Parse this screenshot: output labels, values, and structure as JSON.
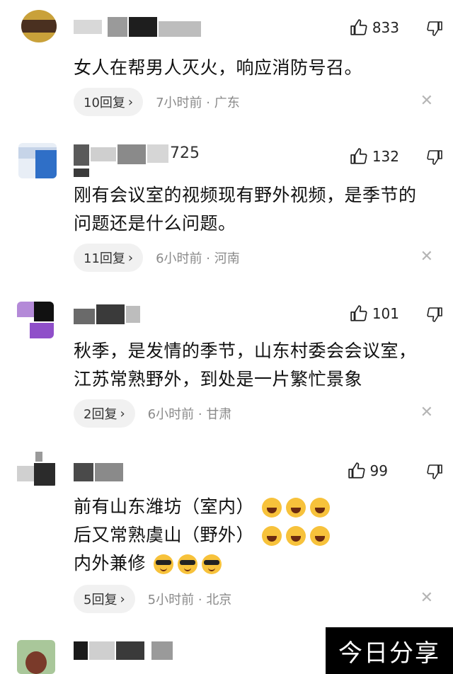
{
  "comments": [
    {
      "likes": "833",
      "text": [
        "女人在帮男人灭火，响应消防号召。"
      ],
      "replies": "10回复",
      "time": "7小时前",
      "location": "广东",
      "name_fragment": ""
    },
    {
      "likes": "132",
      "text": [
        "刚有会议室的视频现有野外视频，是季节的",
        "问题还是什么问题。"
      ],
      "replies": "11回复",
      "time": "6小时前",
      "location": "河南",
      "name_fragment": "725"
    },
    {
      "likes": "101",
      "text": [
        "秋季，是发情的季节，山东村委会会议室，",
        "江苏常熟野外，到处是一片繁忙景象"
      ],
      "replies": "2回复",
      "time": "6小时前",
      "location": "甘肃",
      "name_fragment": ""
    },
    {
      "likes": "99",
      "text": [
        "前有山东潍坊（室内）",
        "后又常熟虞山（野外）",
        "内外兼修"
      ],
      "replies": "5回复",
      "time": "5小时前",
      "location": "北京",
      "name_fragment": ""
    }
  ],
  "dot_separator": "·",
  "chevron": "›",
  "close_glyph": "✕",
  "watermark": "今日分享",
  "icons": {
    "like": "thumbs-up-icon",
    "dislike": "thumbs-down-icon",
    "close": "close-icon"
  }
}
